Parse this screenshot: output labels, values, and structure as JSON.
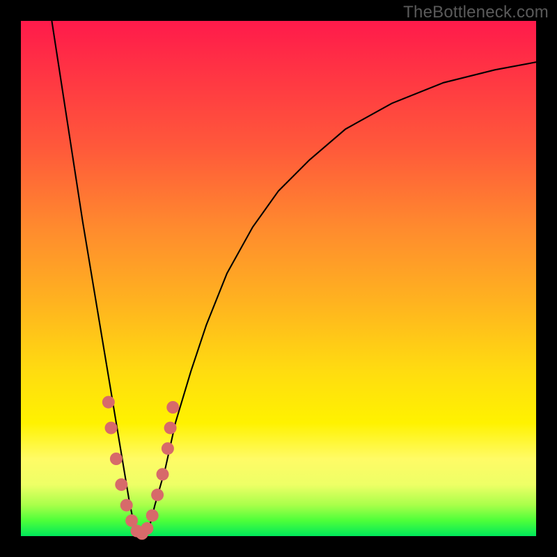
{
  "watermark": "TheBottleneck.com",
  "chart_data": {
    "type": "line",
    "title": "",
    "xlabel": "",
    "ylabel": "",
    "xlim": [
      0,
      100
    ],
    "ylim": [
      0,
      100
    ],
    "series": [
      {
        "name": "bottleneck-curve",
        "x": [
          6,
          8,
          10,
          12,
          14,
          16,
          17,
          18,
          19,
          20,
          21,
          22,
          23,
          24,
          25,
          26,
          28,
          30,
          33,
          36,
          40,
          45,
          50,
          56,
          63,
          72,
          82,
          92,
          100
        ],
        "y": [
          100,
          87,
          74,
          61,
          49,
          37,
          31,
          25,
          19,
          13,
          7,
          2,
          0,
          0,
          2,
          6,
          13,
          22,
          32,
          41,
          51,
          60,
          67,
          73,
          79,
          84,
          88,
          90.5,
          92
        ]
      }
    ],
    "points": [
      {
        "name": "p1",
        "x": 17.0,
        "y": 26
      },
      {
        "name": "p2",
        "x": 17.5,
        "y": 21
      },
      {
        "name": "p3",
        "x": 18.5,
        "y": 15
      },
      {
        "name": "p4",
        "x": 19.5,
        "y": 10
      },
      {
        "name": "p5",
        "x": 20.5,
        "y": 6
      },
      {
        "name": "p6",
        "x": 21.5,
        "y": 3
      },
      {
        "name": "p7",
        "x": 22.5,
        "y": 1
      },
      {
        "name": "p8",
        "x": 23.5,
        "y": 0.5
      },
      {
        "name": "p9",
        "x": 24.5,
        "y": 1.5
      },
      {
        "name": "p10",
        "x": 25.5,
        "y": 4
      },
      {
        "name": "p11",
        "x": 26.5,
        "y": 8
      },
      {
        "name": "p12",
        "x": 27.5,
        "y": 12
      },
      {
        "name": "p13",
        "x": 28.5,
        "y": 17
      },
      {
        "name": "p14",
        "x": 29.0,
        "y": 21
      },
      {
        "name": "p15",
        "x": 29.5,
        "y": 25
      }
    ],
    "gradient_stops": [
      {
        "pos": 0,
        "color": "#ff1a4b"
      },
      {
        "pos": 25,
        "color": "#ff5a3a"
      },
      {
        "pos": 55,
        "color": "#ffb41f"
      },
      {
        "pos": 78,
        "color": "#fff200"
      },
      {
        "pos": 100,
        "color": "#00e85b"
      }
    ]
  }
}
